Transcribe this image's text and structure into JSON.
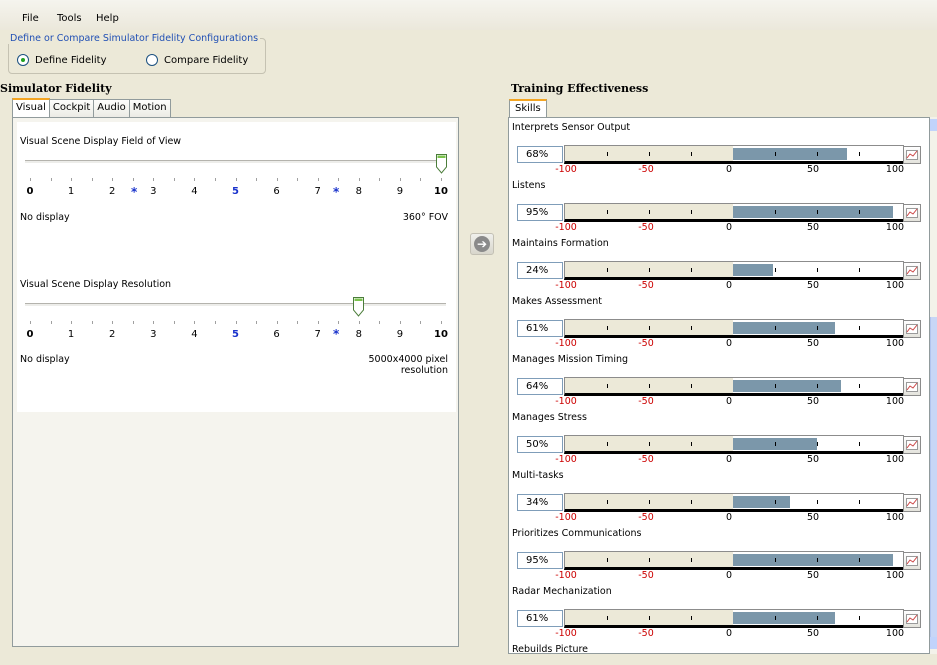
{
  "menu": [
    "File",
    "Tools",
    "Help"
  ],
  "config_group": {
    "title": "Define or Compare Simulator Fidelity Configurations",
    "options": [
      "Define Fidelity",
      "Compare Fidelity"
    ],
    "selected": "Define Fidelity"
  },
  "simulator_fidelity": {
    "title": "Simulator Fidelity",
    "tabs": [
      "Visual",
      "Cockpit",
      "Audio",
      "Motion"
    ],
    "active_tab": "Visual",
    "sliders": [
      {
        "label": "Visual Scene Display Field of View",
        "value": 10,
        "scale_numbers": [
          "0",
          "1",
          "2",
          "3",
          "4",
          "5",
          "6",
          "7",
          "8",
          "9",
          "10"
        ],
        "min_text": "No display",
        "max_text": "360° FOV"
      },
      {
        "label": "Visual Scene Display Resolution",
        "value": 8,
        "scale_numbers": [
          "0",
          "1",
          "2",
          "3",
          "4",
          "5",
          "6",
          "7",
          "8",
          "9",
          "10"
        ],
        "min_text": "No display",
        "max_text_line1": "5000x4000 pixel",
        "max_text_line2": "resolution"
      }
    ]
  },
  "training_effectiveness": {
    "title": "Training Effectiveness",
    "tab": "Skills",
    "axis_labels": [
      "-100",
      "-50",
      "0",
      "50",
      "100"
    ],
    "skills": [
      {
        "name": "Interprets Sensor Output",
        "pct": "68%",
        "value": 68
      },
      {
        "name": "Listens",
        "pct": "95%",
        "value": 95
      },
      {
        "name": "Maintains Formation",
        "pct": "24%",
        "value": 24
      },
      {
        "name": "Makes Assessment",
        "pct": "61%",
        "value": 61
      },
      {
        "name": "Manages Mission Timing",
        "pct": "64%",
        "value": 64
      },
      {
        "name": "Manages Stress",
        "pct": "50%",
        "value": 50
      },
      {
        "name": "Multi-tasks",
        "pct": "34%",
        "value": 34
      },
      {
        "name": "Prioritizes Communications",
        "pct": "95%",
        "value": 95
      },
      {
        "name": "Radar Mechanization",
        "pct": "61%",
        "value": 61
      }
    ],
    "partial_next": "Rebuilds Picture"
  }
}
